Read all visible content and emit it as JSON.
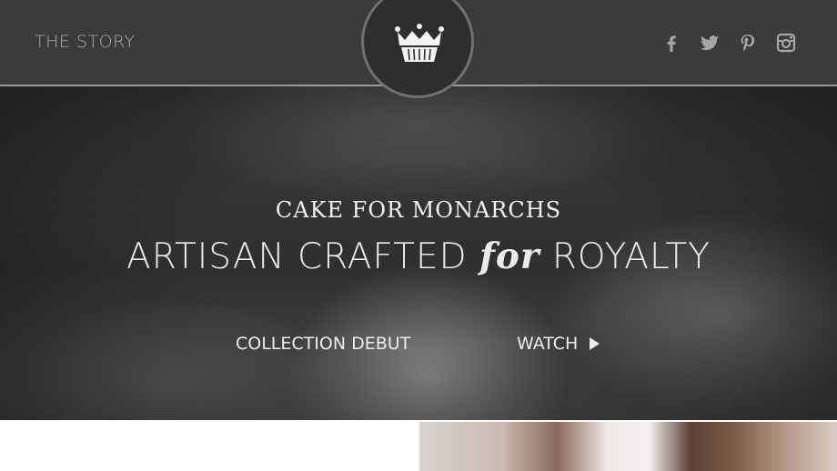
{
  "header": {
    "nav_label": "THE STORY",
    "logo_icon": "crown-cupcake-icon",
    "social": [
      {
        "icon": "facebook-icon"
      },
      {
        "icon": "twitter-icon"
      },
      {
        "icon": "pinterest-icon"
      },
      {
        "icon": "instagram-icon"
      }
    ]
  },
  "hero": {
    "brand": "CAKE FOR MONARCHS",
    "tagline_before": "ARTISAN CRAFTED ",
    "tagline_for": "for",
    "tagline_after": " ROYALTY",
    "collection_link": "COLLECTION DEBUT",
    "watch_link": "WATCH",
    "watch_icon": "play-icon"
  },
  "colors": {
    "header_bg": "#3b3b3b",
    "text_light": "#eeeeee",
    "nav_text": "#a9a9a9"
  }
}
